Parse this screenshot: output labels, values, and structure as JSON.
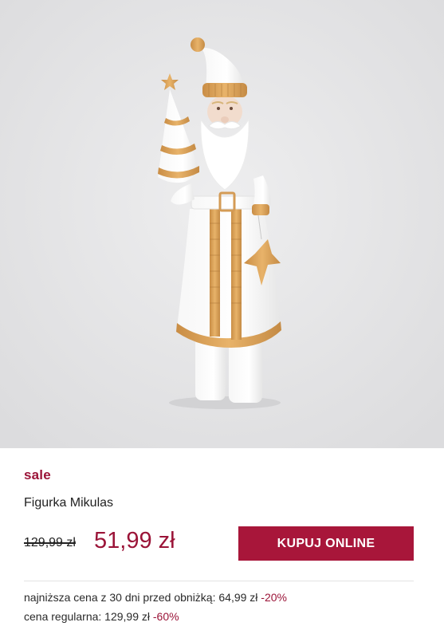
{
  "product": {
    "badge": "sale",
    "name": "Figurka Mikulas",
    "old_price": "129,99 zł",
    "new_price": "51,99 zł",
    "buy_button": "KUPUJ ONLINE",
    "lowest_price_label": "najniższa cena z 30 dni przed obniżką: 64,99 zł",
    "lowest_price_discount": "-20%",
    "regular_price_label": "cena regularna: 129,99 zł",
    "regular_price_discount": "-60%"
  },
  "colors": {
    "accent": "#9b1438",
    "button": "#a8163a",
    "image_background": "#e6e6e8",
    "gold": "#d9a25a"
  }
}
